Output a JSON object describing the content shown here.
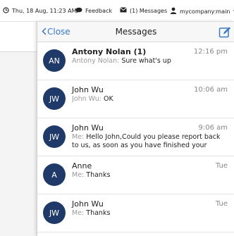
{
  "topbar": {
    "datetime": "Thu, 18 Aug, 11:23 AM",
    "feedback": "Feedback",
    "messages": "(1) Messages",
    "user": "mycompany:main"
  },
  "panel": {
    "close_label": "Close",
    "title": "Messages"
  },
  "messages": [
    {
      "initials": "AN",
      "name": "Antony Nolan (1)",
      "time": "12:16 pm",
      "sender": "Antony Nolan:",
      "text": "Sure what's up",
      "unread": true
    },
    {
      "initials": "JW",
      "name": "John Wu",
      "time": "10:06 am",
      "sender": "John Wu:",
      "text": "OK",
      "unread": false
    },
    {
      "initials": "JW",
      "name": "John Wu",
      "time": "9:06 am",
      "sender": "Me:",
      "text": "Hello John,Could you please report back to us, as soon as you have finished your current…",
      "unread": false
    },
    {
      "initials": "A",
      "name": "Anne",
      "time": "Tue",
      "sender": "Me:",
      "text": "Thanks",
      "unread": false
    },
    {
      "initials": "JW",
      "name": "John Wu",
      "time": "Tue",
      "sender": "Me:",
      "text": "Thanks",
      "unread": false
    }
  ],
  "colors": {
    "accent": "#3a78c3",
    "avatar_bg": "#1f3a68"
  }
}
